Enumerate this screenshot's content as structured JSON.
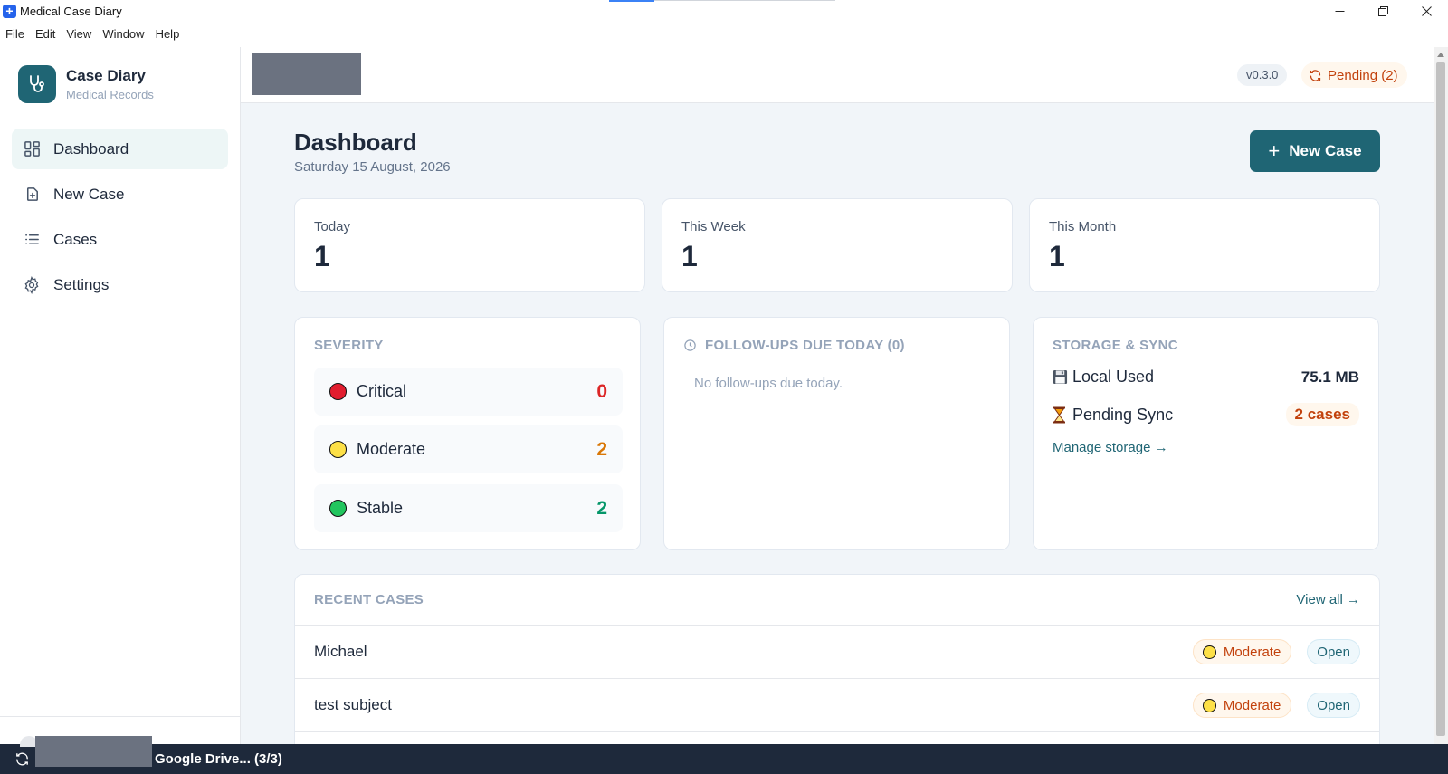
{
  "window": {
    "title": "Medical Case Diary",
    "controls": [
      "minimize",
      "maximize",
      "close"
    ]
  },
  "menu": [
    "File",
    "Edit",
    "View",
    "Window",
    "Help"
  ],
  "brand": {
    "name": "Case Diary",
    "subtitle": "Medical Records"
  },
  "sidebar": {
    "items": [
      {
        "label": "Dashboard",
        "icon": "grid-icon",
        "active": true
      },
      {
        "label": "New Case",
        "icon": "file-plus-icon",
        "active": false
      },
      {
        "label": "Cases",
        "icon": "list-icon",
        "active": false
      },
      {
        "label": "Settings",
        "icon": "gear-icon",
        "active": false
      }
    ]
  },
  "topbar": {
    "version": "v0.3.0",
    "pending": "Pending (2)"
  },
  "page": {
    "title": "Dashboard",
    "date": "Saturday 15 August, 2026",
    "new_case_label": "New Case"
  },
  "stats": [
    {
      "label": "Today",
      "value": "1"
    },
    {
      "label": "This Week",
      "value": "1"
    },
    {
      "label": "This Month",
      "value": "1"
    }
  ],
  "severity": {
    "title": "SEVERITY",
    "rows": [
      {
        "name": "Critical",
        "count": "0",
        "dot_color": "#e11d2e",
        "count_color": "#dc2626"
      },
      {
        "name": "Moderate",
        "count": "2",
        "dot_color": "#fde047",
        "count_color": "#d97706"
      },
      {
        "name": "Stable",
        "count": "2",
        "dot_color": "#22c55e",
        "count_color": "#059669"
      }
    ]
  },
  "followups": {
    "title": "FOLLOW-UPS DUE TODAY (0)",
    "empty": "No follow-ups due today."
  },
  "storage": {
    "title": "STORAGE & SYNC",
    "local_label": "Local Used",
    "local_value": "75.1 MB",
    "sync_label": "Pending Sync",
    "sync_value": "2 cases",
    "manage_link": "Manage storage →"
  },
  "recent": {
    "title": "RECENT CASES",
    "view_all": "View all →",
    "rows": [
      {
        "name": "Michael",
        "severity": "Moderate",
        "status": "Open"
      },
      {
        "name": "test subject",
        "severity": "Moderate",
        "status": "Open"
      }
    ]
  },
  "bottombar": {
    "status": "Google Drive... (3/3)"
  },
  "colors": {
    "accent": "#1f6574",
    "pending": "#c2410c"
  }
}
